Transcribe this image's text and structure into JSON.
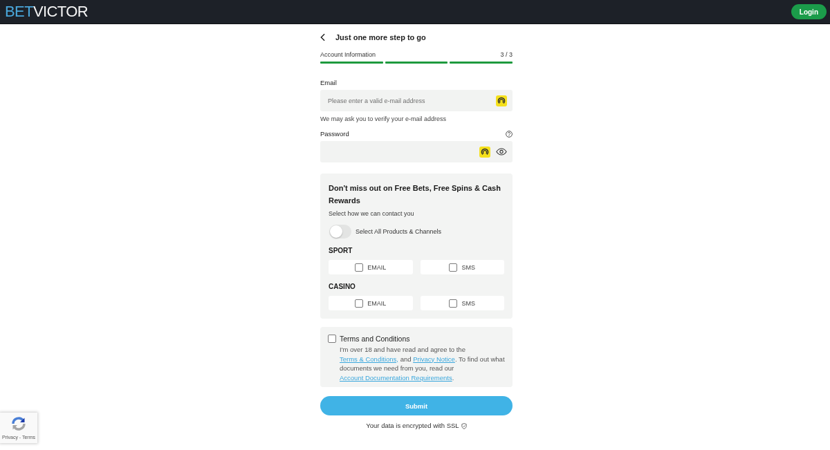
{
  "header": {
    "logo": {
      "part_1": "BET",
      "part_2": "VICTOR"
    },
    "login_button": "Login"
  },
  "signup": {
    "title": "Just one more step to go",
    "step_label": "Account Information",
    "step_counter": "3 / 3",
    "steps": [
      {
        "complete": true
      },
      {
        "complete": true
      },
      {
        "complete": true
      }
    ],
    "fields": [
      {
        "kind": "email",
        "label": "Email",
        "placeholder": "Please enter a valid e-mail address",
        "hint": "We may ask you to verify your e-mail address"
      },
      {
        "kind": "password",
        "label": "Password"
      }
    ]
  },
  "marketing": {
    "heading": "Don't miss out on Free Bets, Free Spins & Cash Rewards",
    "subheading": "Select how we can contact you",
    "select_all": {
      "label": "Select All Products & Channels",
      "on": false
    },
    "groups": [
      {
        "name": "SPORT",
        "options": [
          {
            "label": "EMAIL",
            "checked": false
          },
          {
            "label": "SMS",
            "checked": false
          }
        ]
      },
      {
        "name": "CASINO",
        "options": [
          {
            "label": "EMAIL",
            "checked": false
          },
          {
            "label": "SMS",
            "checked": false
          }
        ]
      }
    ]
  },
  "terms": {
    "title": "Terms and Conditions",
    "checked": false,
    "text": [
      {
        "kind": "text",
        "text": "I'm over 18 and have read and agree to the "
      },
      {
        "kind": "link",
        "text": "Terms & Conditions,"
      },
      {
        "kind": "text",
        "text": " and "
      },
      {
        "kind": "link",
        "text": "Privacy Notice"
      },
      {
        "kind": "text",
        "text": ". To find out what documents we need from you, read our "
      },
      {
        "kind": "link",
        "text": "Account Documentation Requirements"
      },
      {
        "kind": "text",
        "text": "."
      }
    ]
  },
  "submit_button": "Submit",
  "security_note": "Your data is encrypted with SSL",
  "recaptcha": {
    "links": "Privacy - Terms"
  }
}
